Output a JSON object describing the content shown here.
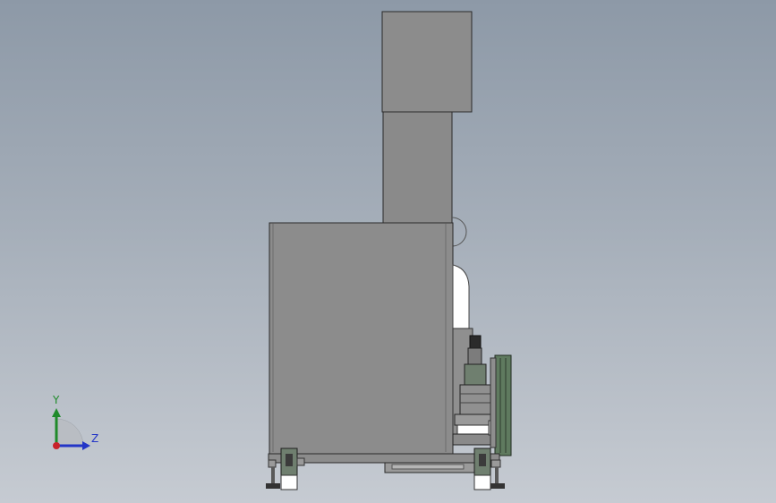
{
  "viewport": {
    "background_top": "#8d99a7",
    "background_bottom": "#c6cbd2"
  },
  "model": {
    "body_color": "#8c8c8c",
    "edge_color": "#2a2a2a",
    "accent_color": "#5f7a5f",
    "highlight_color": "#ffffff"
  },
  "triad": {
    "y_label": "Y",
    "z_label": "Z",
    "y_color": "#1f8a2a",
    "z_color": "#2335c7",
    "x_color": "#c8232a"
  }
}
